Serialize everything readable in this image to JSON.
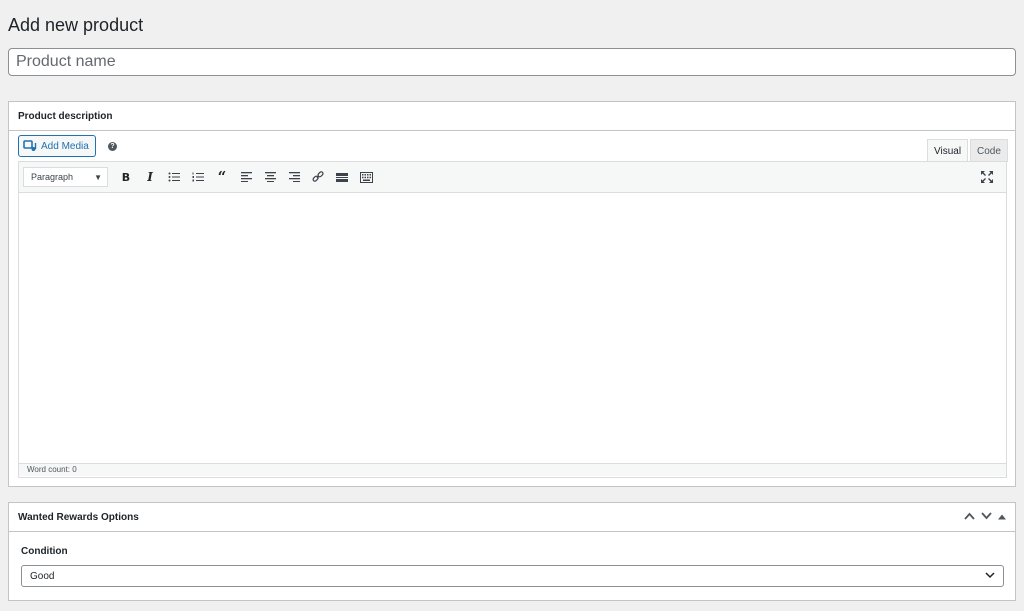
{
  "page": {
    "title": "Add new product",
    "title_placeholder": "Product name"
  },
  "description_box": {
    "title": "Product description",
    "add_media_label": "Add Media",
    "help_icon": "help-icon",
    "tabs": {
      "visual": "Visual",
      "code": "Code"
    },
    "active_tab": "Visual",
    "format_select": "Paragraph",
    "toolbar_buttons": [
      "bold",
      "italic",
      "bulleted-list",
      "numbered-list",
      "blockquote",
      "align-left",
      "align-center",
      "align-right",
      "insert-link",
      "read-more",
      "toolbar-toggle"
    ],
    "word_count": "Word count: 0"
  },
  "rewards_box": {
    "title": "Wanted Rewards Options",
    "condition_label": "Condition",
    "condition_value": "Good"
  },
  "colors": {
    "background": "#f0f0f1",
    "accent": "#2271b1",
    "border": "#c3c4c7"
  }
}
